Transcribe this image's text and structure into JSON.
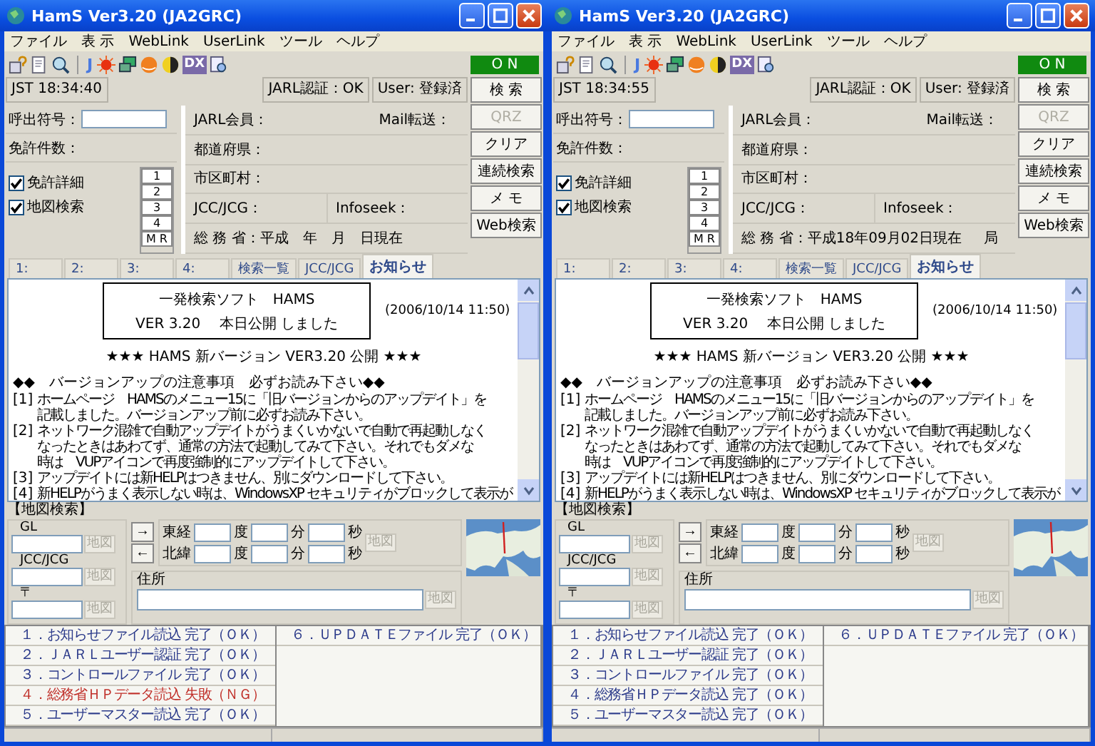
{
  "windows": [
    {
      "title": "HamS Ver3.20 (JA2GRC)",
      "menu": [
        "ファイル",
        "表 示",
        "WebLink",
        "UserLink",
        "ツール",
        "ヘルプ"
      ],
      "toolbar_texts": [
        "J",
        "DX"
      ],
      "connection": "O N",
      "clock": "JST 18:34:40",
      "jarl_auth": "JARL認証：OK",
      "user": "User: 登録済",
      "callsign_label": "呼出符号：",
      "license_count_label": "免許件数：",
      "checkboxes": [
        {
          "label": "免許詳細",
          "checked": true
        },
        {
          "label": "地図検索",
          "checked": true
        }
      ],
      "memory_buttons": [
        "1",
        "2",
        "3",
        "4",
        "M R"
      ],
      "jarl_member": "JARL会員：",
      "mail_forward": "Mail転送：",
      "prefecture": "都道府県：",
      "city": "市区町村：",
      "jcc": "JCC/JCG：",
      "infoseek": "Infoseek：",
      "ministry": "総 務 省：平成　年　月　日現在",
      "side_buttons": [
        {
          "label": "検 索",
          "disabled": false
        },
        {
          "label": "QRZ",
          "disabled": true
        },
        {
          "label": "クリア",
          "disabled": false
        },
        {
          "label": "連続検索",
          "disabled": false
        },
        {
          "label": "メ モ",
          "disabled": false
        },
        {
          "label": "Web検索",
          "disabled": false
        }
      ],
      "tabs": [
        {
          "label": "1:",
          "selected": false
        },
        {
          "label": "2:",
          "selected": false
        },
        {
          "label": "3:",
          "selected": false
        },
        {
          "label": "4:",
          "selected": false
        },
        {
          "label": "検索一覧",
          "selected": false
        },
        {
          "label": "JCC/JCG",
          "selected": false
        },
        {
          "label": "お知らせ",
          "selected": true
        }
      ],
      "notice": {
        "box_title": "一発検索ソフト　HAMS",
        "box_subtitle": "VER 3.20　 本日公開 しました",
        "date": "(2006/10/14 11:50)",
        "headline": "★★★ HAMS 新バージョン VER3.20 公開 ★★★",
        "heading": "◆◆　バージョンアップの注意事項　必ずお読み下さい◆◆",
        "items": [
          {
            "mark": "[1]",
            "lines": [
              "ホームページ　HAMSのメニュー15に「旧バージョンからのアップデイト」を",
              "記載しました。バージョンアップ前に必ずお読み下さい。"
            ]
          },
          {
            "mark": "[2]",
            "lines": [
              "ネットワーク混雑で自動アップデイトがうまくいかないで自動で再起動しなく",
              "なったときはあわてず、通常の方法で起動してみて下さい。それでもダメな",
              "時は　VUPアイコンで再度強制的にアップデイトして下さい。"
            ]
          },
          {
            "mark": "[3]",
            "lines": [
              "アップデイトには新HELPはつきません、別にダウンロードして下さい。"
            ]
          },
          {
            "mark": "[4]",
            "lines": [
              "新HELPがうまく表示しない時は、WindowsXP セキュリティがブロックして表示が"
            ]
          }
        ]
      },
      "map_search": {
        "title": "【地図検索】",
        "gl_label": "GL",
        "jcc_label": "JCC/JCG",
        "zip_label": "〒",
        "map_buttons": [
          "地図",
          "地図",
          "地図",
          "地図",
          "地図"
        ],
        "arrows": [
          "→",
          "←"
        ],
        "coordinate_rows": [
          {
            "label": "東経",
            "units": [
              "度",
              "分",
              "秒"
            ]
          },
          {
            "label": "北緯",
            "units": [
              "度",
              "分",
              "秒"
            ]
          }
        ],
        "address_label": "住所"
      },
      "status": {
        "columns": [
          [
            {
              "text": "１．お知らせファイル読込 完了（ＯＫ）",
              "color": "#2b3a8a"
            },
            {
              "text": "２．ＪＡＲＬユーザー認証 完了（ＯＫ）",
              "color": "#2b3a8a"
            },
            {
              "text": "３．コントロールファイル 完了（ＯＫ）",
              "color": "#2b3a8a"
            },
            {
              "text": "４．総務省ＨＰデータ読込 失敗（ＮＧ）",
              "color": "#c0302a"
            },
            {
              "text": "５．ユーザーマスター読込 完了（ＯＫ）",
              "color": "#2b3a8a"
            }
          ],
          [
            {
              "text": "６．ＵＰＤＡＴＥファイル 完了（ＯＫ）",
              "color": "#2b3a8a"
            }
          ]
        ]
      }
    },
    {
      "title": "HamS Ver3.20 (JA2GRC)",
      "menu": [
        "ファイル",
        "表 示",
        "WebLink",
        "UserLink",
        "ツール",
        "ヘルプ"
      ],
      "toolbar_texts": [
        "J",
        "DX"
      ],
      "connection": "O N",
      "clock": "JST 18:34:55",
      "jarl_auth": "JARL認証：OK",
      "user": "User: 登録済",
      "callsign_label": "呼出符号：",
      "license_count_label": "免許件数：",
      "checkboxes": [
        {
          "label": "免許詳細",
          "checked": true
        },
        {
          "label": "地図検索",
          "checked": true
        }
      ],
      "memory_buttons": [
        "1",
        "2",
        "3",
        "4",
        "M R"
      ],
      "jarl_member": "JARL会員：",
      "mail_forward": "Mail転送：",
      "prefecture": "都道府県：",
      "city": "市区町村：",
      "jcc": "JCC/JCG：",
      "infoseek": "Infoseek：",
      "ministry": "総 務 省：平成18年09月02日現在",
      "station": "局",
      "side_buttons": [
        {
          "label": "検 索",
          "disabled": false
        },
        {
          "label": "QRZ",
          "disabled": true
        },
        {
          "label": "クリア",
          "disabled": false
        },
        {
          "label": "連続検索",
          "disabled": false
        },
        {
          "label": "メ モ",
          "disabled": false
        },
        {
          "label": "Web検索",
          "disabled": false
        }
      ],
      "tabs": [
        {
          "label": "1:",
          "selected": false
        },
        {
          "label": "2:",
          "selected": false
        },
        {
          "label": "3:",
          "selected": false
        },
        {
          "label": "4:",
          "selected": false
        },
        {
          "label": "検索一覧",
          "selected": false
        },
        {
          "label": "JCC/JCG",
          "selected": false
        },
        {
          "label": "お知らせ",
          "selected": true
        }
      ],
      "notice": {
        "box_title": "一発検索ソフト　HAMS",
        "box_subtitle": "VER 3.20　 本日公開 しました",
        "date": "(2006/10/14 11:50)",
        "headline": "★★★ HAMS 新バージョン VER3.20 公開 ★★★",
        "heading": "◆◆　バージョンアップの注意事項　必ずお読み下さい◆◆",
        "items": [
          {
            "mark": "[1]",
            "lines": [
              "ホームページ　HAMSのメニュー15に「旧バージョンからのアップデイト」を",
              "記載しました。バージョンアップ前に必ずお読み下さい。"
            ]
          },
          {
            "mark": "[2]",
            "lines": [
              "ネットワーク混雑で自動アップデイトがうまくいかないで自動で再起動しなく",
              "なったときはあわてず、通常の方法で起動してみて下さい。それでもダメな",
              "時は　VUPアイコンで再度強制的にアップデイトして下さい。"
            ]
          },
          {
            "mark": "[3]",
            "lines": [
              "アップデイトには新HELPはつきません、別にダウンロードして下さい。"
            ]
          },
          {
            "mark": "[4]",
            "lines": [
              "新HELPがうまく表示しない時は、WindowsXP セキュリティがブロックして表示が"
            ]
          }
        ]
      },
      "map_search": {
        "title": "【地図検索】",
        "gl_label": "GL",
        "jcc_label": "JCC/JCG",
        "zip_label": "〒",
        "map_buttons": [
          "地図",
          "地図",
          "地図",
          "地図",
          "地図"
        ],
        "arrows": [
          "→",
          "←"
        ],
        "coordinate_rows": [
          {
            "label": "東経",
            "units": [
              "度",
              "分",
              "秒"
            ]
          },
          {
            "label": "北緯",
            "units": [
              "度",
              "分",
              "秒"
            ]
          }
        ],
        "address_label": "住所"
      },
      "status": {
        "columns": [
          [
            {
              "text": "１．お知らせファイル読込 完了（ＯＫ）",
              "color": "#2b3a8a"
            },
            {
              "text": "２．ＪＡＲＬユーザー認証 完了（ＯＫ）",
              "color": "#2b3a8a"
            },
            {
              "text": "３．コントロールファイル 完了（ＯＫ）",
              "color": "#2b3a8a"
            },
            {
              "text": "４．総務省ＨＰデータ読込 完了（ＯＫ）",
              "color": "#2b3a8a"
            },
            {
              "text": "５．ユーザーマスター読込 完了（ＯＫ）",
              "color": "#2b3a8a"
            }
          ],
          [
            {
              "text": "６．ＵＰＤＡＴＥファイル 完了（ＯＫ）",
              "color": "#2b3a8a"
            }
          ]
        ]
      }
    }
  ]
}
